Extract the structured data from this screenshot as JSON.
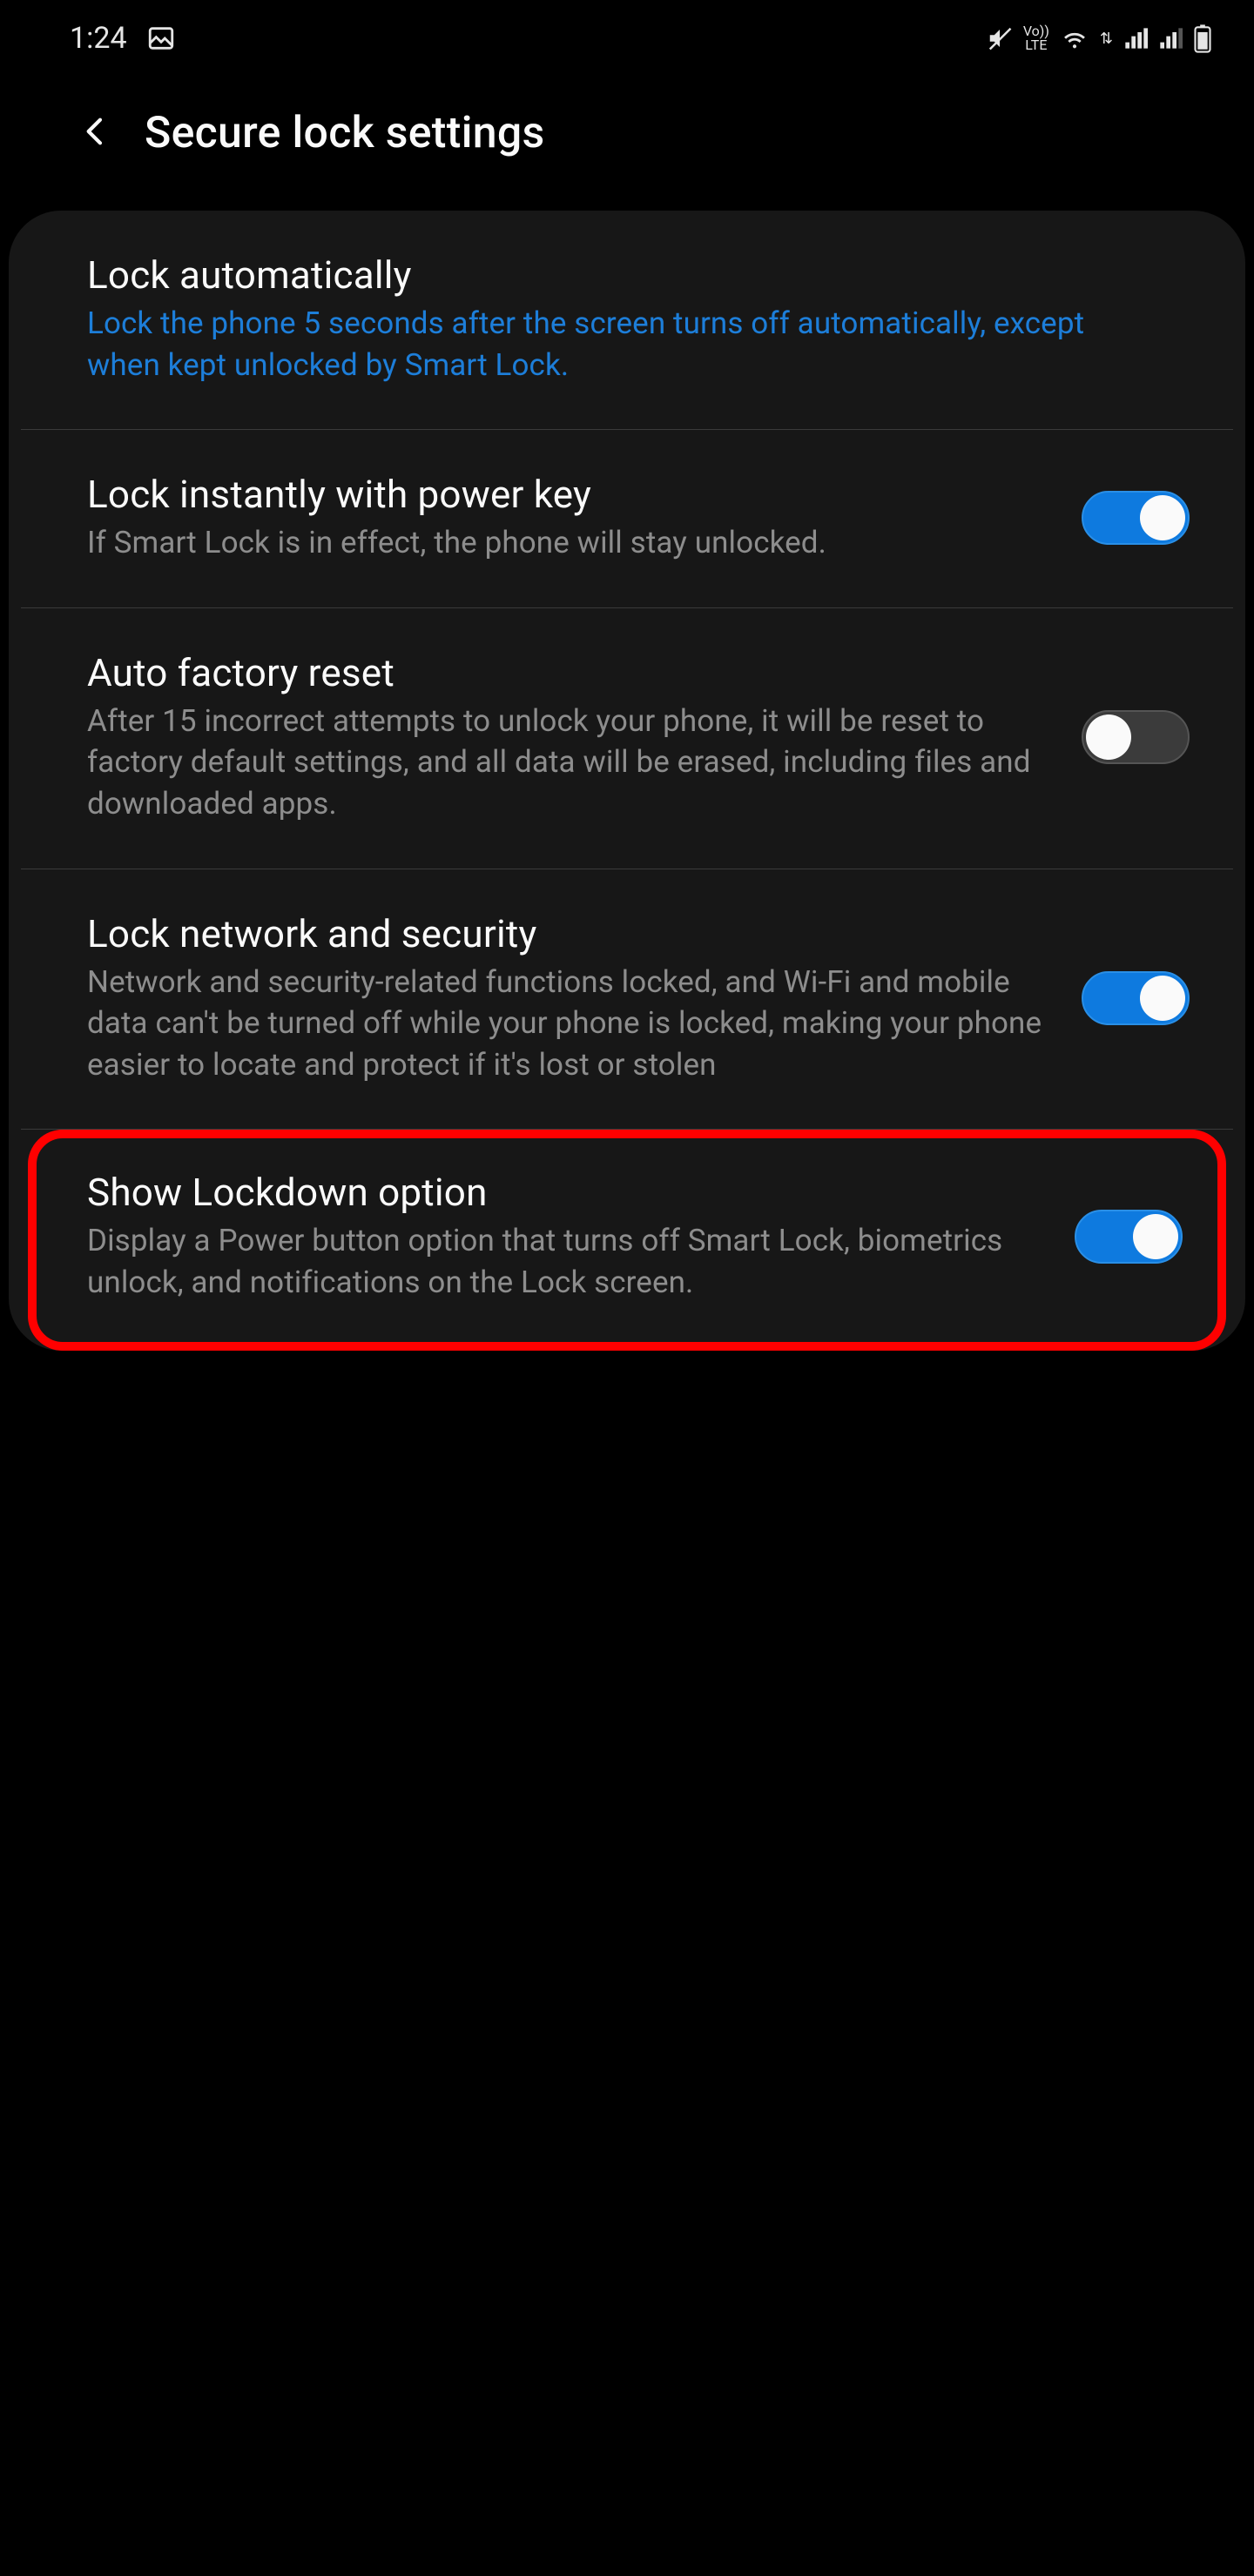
{
  "statusbar": {
    "time": "1:24",
    "icons": {
      "picture": "picture-icon",
      "mute": "mute-icon",
      "volte": "Vo)) LTE",
      "wifi": "wifi-icon",
      "signal1": "signal-icon",
      "signal2": "signal-icon",
      "battery": "battery-icon"
    }
  },
  "header": {
    "title": "Secure lock settings"
  },
  "colors": {
    "accent": "#1d7ed9",
    "toggle_on": "#0e7adf",
    "highlight_border": "#ff0000"
  },
  "rows": [
    {
      "title": "Lock automatically",
      "desc": "Lock the phone 5 seconds after the screen turns off automatically, except when kept unlocked by Smart Lock.",
      "desc_accent": true,
      "has_toggle": false
    },
    {
      "title": "Lock instantly with power key",
      "desc": "If Smart Lock is in effect, the phone will stay unlocked.",
      "has_toggle": true,
      "toggle_on": true
    },
    {
      "title": "Auto factory reset",
      "desc": "After 15 incorrect attempts to unlock your phone, it will be reset to factory default settings, and all data will be erased, including files and downloaded apps.",
      "has_toggle": true,
      "toggle_on": false
    },
    {
      "title": "Lock network and security",
      "desc": "Network and security-related functions locked, and Wi-Fi and mobile data can't be turned off while your phone is locked, making your phone easier to locate and protect if it's lost or stolen",
      "has_toggle": true,
      "toggle_on": true
    },
    {
      "title": "Show Lockdown option",
      "desc": "Display a Power button option that turns off Smart Lock, biometrics unlock, and notifications on the Lock screen.",
      "has_toggle": true,
      "toggle_on": true,
      "highlighted": true
    }
  ]
}
